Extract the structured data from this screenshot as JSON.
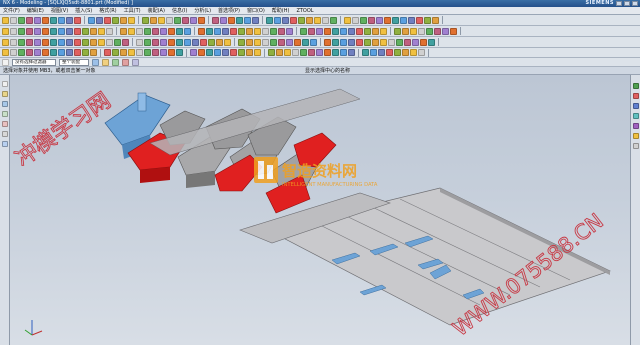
{
  "window": {
    "title": "NX 6 - Modeling - [SQLXJQ5sdt-8801.prt (Modified) ]",
    "brand": "SIEMENS"
  },
  "menu": [
    "文件(F)",
    "编辑(E)",
    "视图(V)",
    "插入(S)",
    "格式(R)",
    "工具(T)",
    "装配(A)",
    "信息(I)",
    "分析(L)",
    "首选项(P)",
    "窗口(O)",
    "帮助(H)",
    "ZTOOL"
  ],
  "filter": {
    "type_filter": "没有选择过滤器",
    "scope": "整个装配"
  },
  "cue_line": "选择对象并使用 MB3，或者双击某一对象",
  "status_line": "显示选择中心的名称",
  "watermarks": {
    "top_left": "冲模学习网",
    "logo_cn": "智造资料网",
    "logo_en": "INTELLIGENT MANUFACTURING DATA",
    "domain": "WWW.075588.CN"
  },
  "toolbar_icon_colors": [
    "#f0c040",
    "#5aa0e0",
    "#60b060",
    "#e06060",
    "#a080d0",
    "#e0a040",
    "#40a0a0",
    "#d0d0d0",
    "#7080c0",
    "#c06080",
    "#90b040",
    "#e07030"
  ],
  "model_colors": {
    "sheet": "#c9c9cc",
    "blue": "#6da3d6",
    "red": "#e02020",
    "grey_part": "#9a9a9c"
  }
}
